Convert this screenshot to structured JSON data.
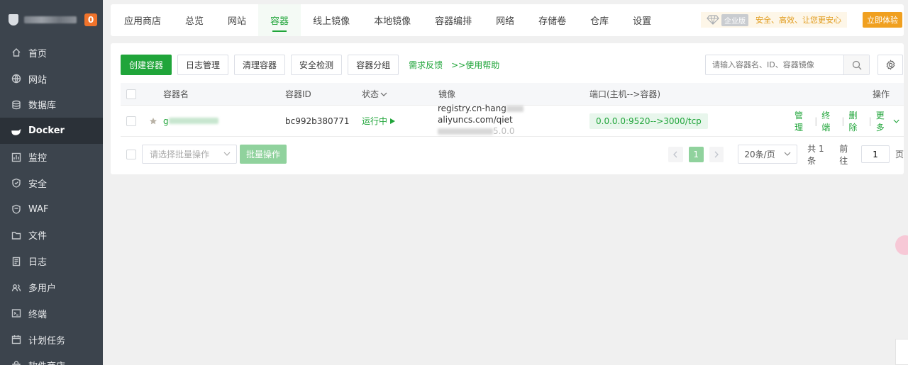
{
  "sidebar": {
    "badge": "0",
    "items": [
      {
        "label": "首页",
        "icon": "home-icon"
      },
      {
        "label": "网站",
        "icon": "globe-icon"
      },
      {
        "label": "数据库",
        "icon": "database-icon"
      },
      {
        "label": "Docker",
        "icon": "docker-icon"
      },
      {
        "label": "监控",
        "icon": "monitor-icon"
      },
      {
        "label": "安全",
        "icon": "shield-icon"
      },
      {
        "label": "WAF",
        "icon": "waf-shield-icon"
      },
      {
        "label": "文件",
        "icon": "folder-icon"
      },
      {
        "label": "日志",
        "icon": "log-icon"
      },
      {
        "label": "多用户",
        "icon": "users-icon"
      },
      {
        "label": "终端",
        "icon": "terminal-icon"
      },
      {
        "label": "计划任务",
        "icon": "calendar-icon"
      },
      {
        "label": "软件商店",
        "icon": "store-icon"
      }
    ],
    "active_index": 3
  },
  "topnav": {
    "tabs": [
      "应用商店",
      "总览",
      "网站",
      "容器",
      "线上镜像",
      "本地镜像",
      "容器编排",
      "网络",
      "存储卷",
      "仓库",
      "设置"
    ],
    "active_tab": "容器",
    "enterprise_tag": "企业版",
    "slogan": "安全、高效、让您更安心",
    "trial_button": "立即体验"
  },
  "toolbar": {
    "create": "创建容器",
    "logs": "日志管理",
    "clean": "清理容器",
    "security": "安全检测",
    "group": "容器分组",
    "feedback": "需求反馈",
    "help": ">>使用帮助",
    "search_placeholder": "请输入容器名、ID、容器镜像"
  },
  "table": {
    "headers": {
      "name": "容器名",
      "id": "容器ID",
      "status": "状态",
      "image": "镜像",
      "ports": "端口(主机-->容器)",
      "actions": "操作"
    },
    "rows": [
      {
        "name": "g",
        "id": "bc992b380771",
        "status": "运行中",
        "image_line1_a": "registry.cn-hang",
        "image_line1_b": "aliyuncs.com/qiet",
        "image_line2": "5.0.0",
        "port": "0.0.0.0:9520-->3000/tcp",
        "ops": [
          "管理",
          "终端",
          "删除",
          "更多"
        ]
      }
    ]
  },
  "footer": {
    "batch_placeholder": "请选择批量操作",
    "batch_button": "批量操作",
    "current_page": "1",
    "page_size": "20条/页",
    "total": "共 1 条",
    "goto_label": "前往",
    "goto_value": "1",
    "page_suffix": "页"
  }
}
